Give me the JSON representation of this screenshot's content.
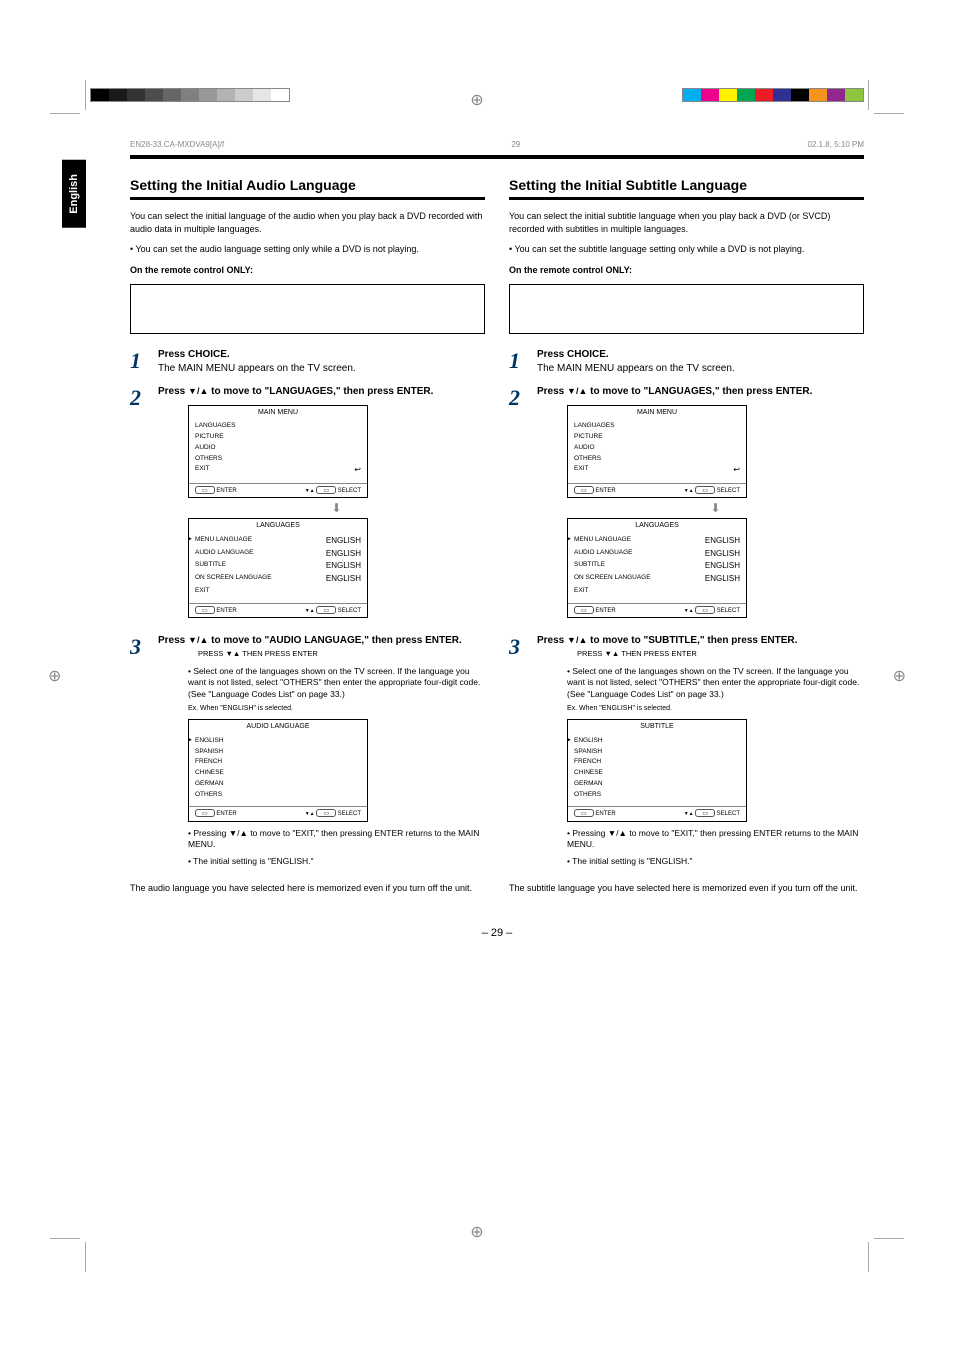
{
  "filename_left": "EN28-33.CA-MXDVA9[A]/f",
  "filename_right": "02.1.8, 5:10 PM",
  "lang_tab": "English",
  "page_number": "– 29 –",
  "left": {
    "section_title": "Setting the Initial Audio Language",
    "intro1": "You can select the initial language of the audio when you play back a DVD recorded with audio data in multiple languages.",
    "intro2_bullet": "• You can set the audio language setting only while a DVD is not playing.",
    "intro3_bold": "On the remote control ONLY:",
    "step1": "Press CHOICE.",
    "step1_sub": "The MAIN MENU appears on the TV screen.",
    "step2_a": "Press ",
    "step2_b": " to move      to \"LANGUAGES,\" then press ENTER.",
    "step2_arrows": "▼/▲",
    "menu1_title": "MAIN MENU",
    "menu1_items": [
      {
        "l": "LANGUAGES",
        "r": ""
      },
      {
        "l": "PICTURE",
        "r": ""
      },
      {
        "l": "AUDIO",
        "r": ""
      },
      {
        "l": "OTHERS",
        "r": ""
      },
      {
        "l": "EXIT",
        "r": "↩"
      }
    ],
    "menu1_foot_l": "ENTER",
    "menu1_foot_r": "SELECT",
    "menu2_title": "LANGUAGES",
    "menu2_items": [
      {
        "l": "MENU LANGUAGE",
        "r": "ENGLISH",
        "sel": true
      },
      {
        "l": "AUDIO LANGUAGE",
        "r": "ENGLISH"
      },
      {
        "l": "SUBTITLE",
        "r": "ENGLISH"
      },
      {
        "l": "ON SCREEN LANGUAGE",
        "r": "ENGLISH"
      },
      {
        "l": "EXIT",
        "r": ""
      }
    ],
    "step3_a": "Press ",
    "step3_b": " to move      to \"AUDIO LANGUAGE,\" then press ENTER.",
    "step3_arrows": "▼/▲",
    "prompt": "PRESS ▼▲ THEN PRESS ENTER",
    "note_a": "• Select one of the languages shown on the TV screen. If the language you want is not listed, select \"OTHERS\" then enter the appropriate four-digit code. (See \"Language Codes List\" on page 33.)",
    "ex_caption": "Ex. When \"ENGLISH\" is selected.",
    "menu3_title": "AUDIO LANGUAGE",
    "menu3_items": [
      {
        "l": "ENGLISH",
        "r": "",
        "sel": true
      },
      {
        "l": "SPANISH",
        "r": ""
      },
      {
        "l": "FRENCH",
        "r": ""
      },
      {
        "l": "CHINESE",
        "r": ""
      },
      {
        "l": "GERMAN",
        "r": ""
      },
      {
        "l": "OTHERS",
        "r": ""
      }
    ],
    "note_b": "• Pressing ▼/▲ to move      to \"EXIT,\" then pressing ENTER returns to the MAIN MENU.",
    "note_c": "• The initial setting is \"ENGLISH.\"",
    "closing": "The audio language you have selected here is memorized even if you turn off the unit."
  },
  "right": {
    "section_title": "Setting the Initial Subtitle Language",
    "intro1": "You can select the initial subtitle language when you play back a DVD (or SVCD) recorded with subtitles in multiple languages.",
    "intro2_bullet": "• You can set the subtitle language setting only while a DVD is not playing.",
    "intro3_bold": "On the remote control ONLY:",
    "step1": "Press CHOICE.",
    "step1_sub": "The MAIN MENU appears on the TV screen.",
    "step2_a": "Press ",
    "step2_b": " to move      to \"LANGUAGES,\" then press ENTER.",
    "step2_arrows": "▼/▲",
    "menu1_title": "MAIN MENU",
    "menu1_items": [
      {
        "l": "LANGUAGES",
        "r": ""
      },
      {
        "l": "PICTURE",
        "r": ""
      },
      {
        "l": "AUDIO",
        "r": ""
      },
      {
        "l": "OTHERS",
        "r": ""
      },
      {
        "l": "EXIT",
        "r": "↩"
      }
    ],
    "menu1_foot_l": "ENTER",
    "menu1_foot_r": "SELECT",
    "menu2_title": "LANGUAGES",
    "menu2_items": [
      {
        "l": "MENU LANGUAGE",
        "r": "ENGLISH",
        "sel": true
      },
      {
        "l": "AUDIO LANGUAGE",
        "r": "ENGLISH"
      },
      {
        "l": "SUBTITLE",
        "r": "ENGLISH"
      },
      {
        "l": "ON SCREEN LANGUAGE",
        "r": "ENGLISH"
      },
      {
        "l": "EXIT",
        "r": ""
      }
    ],
    "step3_a": "Press ",
    "step3_b": " to move      to \"SUBTITLE,\" then press ENTER.",
    "step3_arrows": "▼/▲",
    "prompt": "PRESS ▼▲ THEN PRESS ENTER",
    "note_a": "• Select one of the languages shown on the TV screen. If the language you want is not listed, select \"OTHERS\" then enter the appropriate four-digit code. (See \"Language Codes List\" on page 33.)",
    "ex_caption": "Ex. When \"ENGLISH\" is selected.",
    "menu3_title": "SUBTITLE",
    "menu3_items": [
      {
        "l": "ENGLISH",
        "r": "",
        "sel": true
      },
      {
        "l": "SPANISH",
        "r": ""
      },
      {
        "l": "FRENCH",
        "r": ""
      },
      {
        "l": "CHINESE",
        "r": ""
      },
      {
        "l": "GERMAN",
        "r": ""
      },
      {
        "l": "OTHERS",
        "r": ""
      }
    ],
    "note_b": "• Pressing ▼/▲ to move      to \"EXIT,\" then pressing ENTER returns to the MAIN MENU.",
    "note_c": "• The initial setting is \"ENGLISH.\"",
    "closing": "The subtitle language you have selected here is memorized even if you turn off the unit."
  },
  "grays": [
    "#000",
    "#1a1a1a",
    "#333",
    "#4d4d4d",
    "#666",
    "#808080",
    "#999",
    "#b3b3b3",
    "#ccc",
    "#e6e6e6",
    "#fff"
  ],
  "colors": [
    "#00aeef",
    "#ec008c",
    "#fff200",
    "#00a651",
    "#ed1c24",
    "#2e3192",
    "#000000",
    "#f7941d",
    "#92278f",
    "#8dc63f"
  ]
}
